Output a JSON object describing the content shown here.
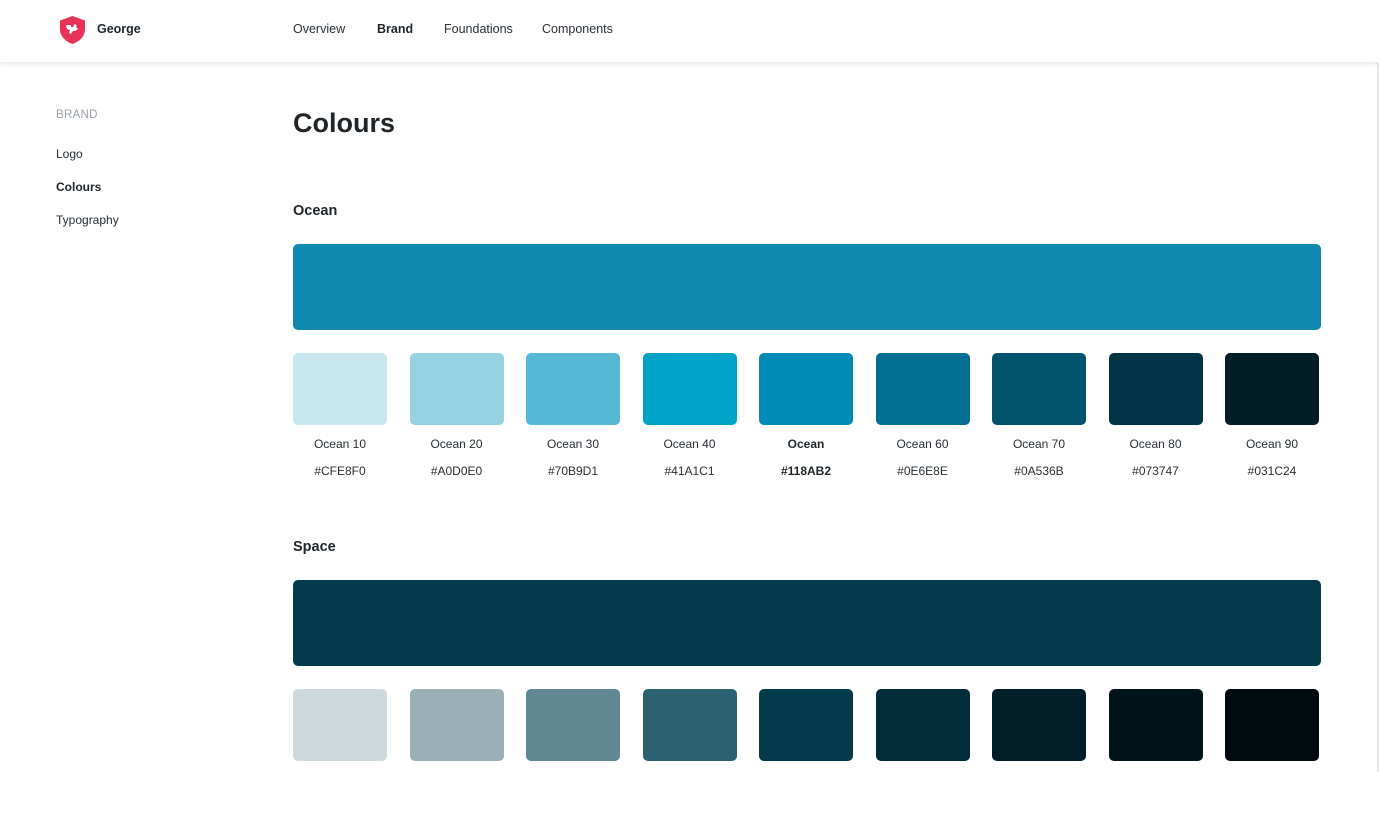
{
  "header": {
    "brand": "George",
    "logo_icon": "shield-logo-icon",
    "logo_color": "#E8325A",
    "nav": [
      {
        "label": "Overview",
        "active": false
      },
      {
        "label": "Brand",
        "active": true
      },
      {
        "label": "Foundations",
        "active": false
      },
      {
        "label": "Components",
        "active": false
      }
    ]
  },
  "sidebar": {
    "heading": "BRAND",
    "items": [
      {
        "label": "Logo",
        "active": false
      },
      {
        "label": "Colours",
        "active": true
      },
      {
        "label": "Typography",
        "active": false
      }
    ]
  },
  "main": {
    "title": "Colours",
    "palettes": [
      {
        "name": "Ocean",
        "hero_color": "#118AB2",
        "swatches": [
          {
            "name": "Ocean 10",
            "hex": "#CFE8F0",
            "color": "#C7E6EE",
            "selected": false
          },
          {
            "name": "Ocean 20",
            "hex": "#A0D0E0",
            "color": "#95D2E2",
            "selected": false
          },
          {
            "name": "Ocean 30",
            "hex": "#70B9D1",
            "color": "#55B9D5",
            "selected": false
          },
          {
            "name": "Ocean 40",
            "hex": "#41A1C1",
            "color": "#00A4C9",
            "selected": false
          },
          {
            "name": "Ocean",
            "hex": "#118AB2",
            "color": "#008BB7",
            "selected": true
          },
          {
            "name": "Ocean 60",
            "hex": "#0E6E8E",
            "color": "#006F92",
            "selected": false
          },
          {
            "name": "Ocean 70",
            "hex": "#0A536B",
            "color": "#00536D",
            "selected": false
          },
          {
            "name": "Ocean 80",
            "hex": "#073747",
            "color": "#003446",
            "selected": false
          },
          {
            "name": "Ocean 90",
            "hex": "#031C24",
            "color": "#011E26",
            "selected": false
          }
        ]
      },
      {
        "name": "Space",
        "hero_color": "#033B4D",
        "swatches": [
          {
            "color": "#CCD8DC"
          },
          {
            "color": "#9AB0B6"
          },
          {
            "color": "#618892"
          },
          {
            "color": "#2B6170"
          },
          {
            "color": "#033A4C"
          },
          {
            "color": "#022C3A"
          },
          {
            "color": "#021F29"
          },
          {
            "color": "#01141A"
          },
          {
            "color": "#010C10"
          }
        ]
      }
    ]
  }
}
